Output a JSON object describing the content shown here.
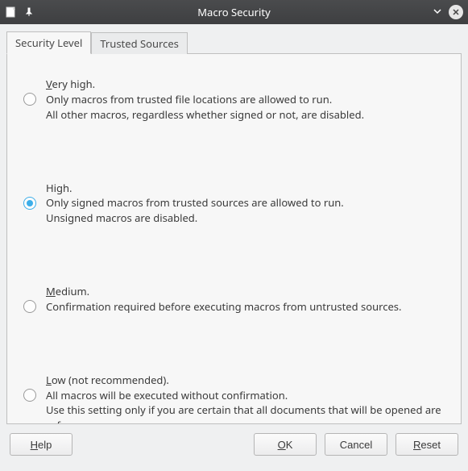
{
  "window": {
    "title": "Macro Security"
  },
  "tabs": {
    "security_level": "Security Level",
    "trusted_sources": "Trusted Sources",
    "active": "security_level"
  },
  "options": {
    "very_high": {
      "title_prefix": "V",
      "title_rest": "ery high.",
      "line1": "Only macros from trusted file locations are allowed to run.",
      "line2": "All other macros, regardless whether signed or not, are disabled.",
      "selected": false
    },
    "high": {
      "title": "High.",
      "line1": "Only signed macros from trusted sources are allowed to run.",
      "line2": "Unsigned macros are disabled.",
      "selected": true
    },
    "medium": {
      "title_prefix": "M",
      "title_rest": "edium.",
      "line1": "Confirmation required before executing macros from untrusted sources.",
      "selected": false
    },
    "low": {
      "title_prefix": "L",
      "title_rest": "ow (not recommended).",
      "line1": "All macros will be executed without confirmation.",
      "line2": "Use this setting only if you are certain that all documents that will be opened are safe.",
      "selected": false
    }
  },
  "buttons": {
    "help_prefix": "H",
    "help_rest": "elp",
    "ok_prefix": "O",
    "ok_rest": "K",
    "cancel": "Cancel",
    "reset_prefix": "R",
    "reset_rest": "eset"
  }
}
